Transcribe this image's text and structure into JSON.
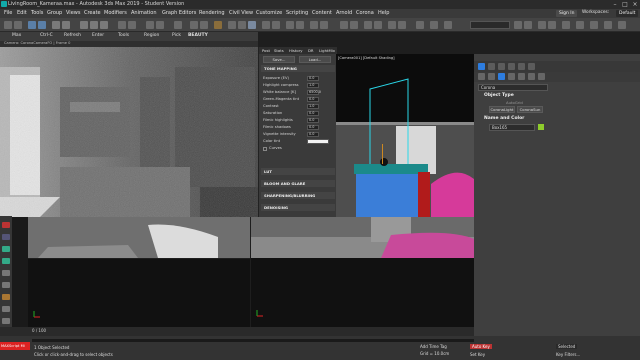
{
  "window": {
    "title": "LivingRoom_Kameraa.max - Autodesk 3ds Max 2019 - Student Version"
  },
  "menu": [
    "File",
    "Edit",
    "Tools",
    "Group",
    "Views",
    "Create",
    "Modifiers",
    "Animation",
    "Graph Editors",
    "Rendering",
    "Civil View",
    "Customize",
    "Scripting",
    "Content",
    "Arnold",
    "Corona",
    "Help"
  ],
  "account": {
    "signin_label": "Sign In",
    "workspace_label": "Workspaces:",
    "workspace_value": "Default"
  },
  "frame_buffer_bar": {
    "items": [
      "Max",
      "Ctrl-C",
      "Refresh",
      "Enter",
      "Tools",
      "Region",
      "Pick",
      "BEAUTY"
    ]
  },
  "frame_buffer_status": "Camera: CoronaCameraFO | Frame 0",
  "fe_panel": {
    "tabs": [
      "Post",
      "Stats",
      "History",
      "DR",
      "LightMix"
    ],
    "buttons": [
      "Save...",
      "Load..."
    ],
    "section_tone": "TONE MAPPING",
    "params": [
      {
        "label": "Exposure (EV)",
        "value": "0.0"
      },
      {
        "label": "Highlight compress",
        "value": "1.0"
      },
      {
        "label": "White balance [K]",
        "value": "6500.0"
      },
      {
        "label": "Green-Magenta tint",
        "value": "0.0"
      },
      {
        "label": "Contrast",
        "value": "1.0"
      },
      {
        "label": "Saturation",
        "value": "0.0"
      },
      {
        "label": "Filmic highlights",
        "value": "0.0"
      },
      {
        "label": "Filmic shadows",
        "value": "0.0"
      },
      {
        "label": "Vignette intensity",
        "value": "0.0"
      },
      {
        "label": "Color tint",
        "value": ""
      }
    ],
    "curves_label": "Curves",
    "sections": [
      "LUT",
      "BLOOM AND GLARE",
      "SHARPENING/BLURRING",
      "DENOISING"
    ]
  },
  "command_panel": {
    "category": "Corona",
    "object_type_heading": "Object Type",
    "autogrid": "AutoGrid",
    "buttons": [
      "CoronaLight",
      "CoronaSun"
    ],
    "name_color_heading": "Name and Color",
    "object_name": "Box165",
    "object_color": "#8ecc2c"
  },
  "viewport": {
    "right_label": "[Camera001] [Default Shading]",
    "top_left_label": "",
    "bottom_left_label": ""
  },
  "status": {
    "selection": "1 Object Selected",
    "hint": "Click or click-and-drag to select objects",
    "script_label": "MAXScript Mi",
    "frame_counter": "0 / 100",
    "grid_label": "Grid = 10.0cm",
    "add_time_tag": "Add Time Tag",
    "autokey": "Auto Key",
    "setkey": "Set Key",
    "selected_label": "Selected",
    "key_filters": "Key Filters..."
  },
  "colors": {
    "accent": "#2d7de0",
    "cyan_gizmo": "#2ad7e8",
    "fur_pink": "#d63a9a",
    "noise_blue": "#3b7ed8"
  }
}
